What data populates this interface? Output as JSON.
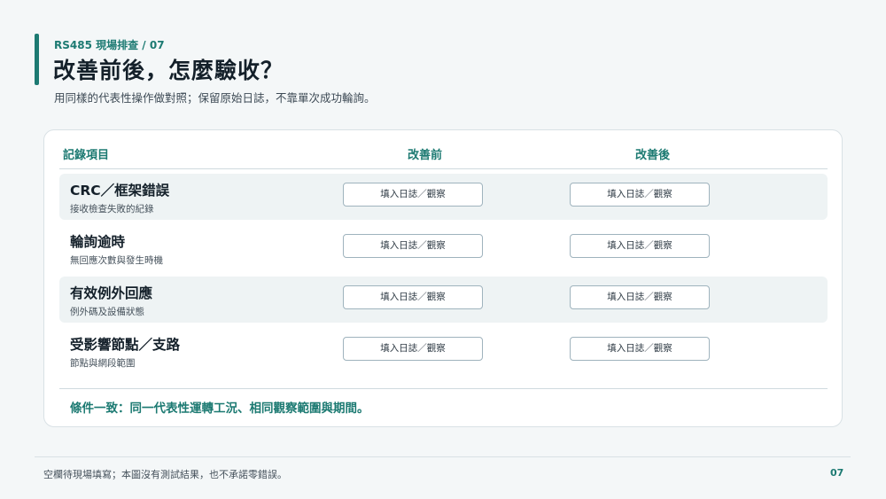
{
  "header": {
    "eyebrow": "RS485 現場排查 / 07",
    "title": "改善前後，怎麼驗收？",
    "subtitle": "用同樣的代表性操作做對照；保留原始日誌，不靠單次成功輪詢。"
  },
  "table": {
    "columns": {
      "item": "記錄項目",
      "before": "改善前",
      "after": "改善後"
    },
    "rows": [
      {
        "name": "CRC／框架錯誤",
        "desc": "接收檢查失敗的紀錄",
        "before": "填入日誌／觀察",
        "after": "填入日誌／觀察"
      },
      {
        "name": "輪詢逾時",
        "desc": "無回應次數與發生時機",
        "before": "填入日誌／觀察",
        "after": "填入日誌／觀察"
      },
      {
        "name": "有效例外回應",
        "desc": "例外碼及設備狀態",
        "before": "填入日誌／觀察",
        "after": "填入日誌／觀察"
      },
      {
        "name": "受影響節點／支路",
        "desc": "節點與網段範圍",
        "before": "填入日誌／觀察",
        "after": "填入日誌／觀察"
      }
    ],
    "condition": "條件一致：同一代表性運轉工況、相同觀察範圍與期間。"
  },
  "footer": {
    "note": "空欄待現場填寫；本圖沒有測試結果，也不承諾零錯誤。",
    "page": "07"
  }
}
